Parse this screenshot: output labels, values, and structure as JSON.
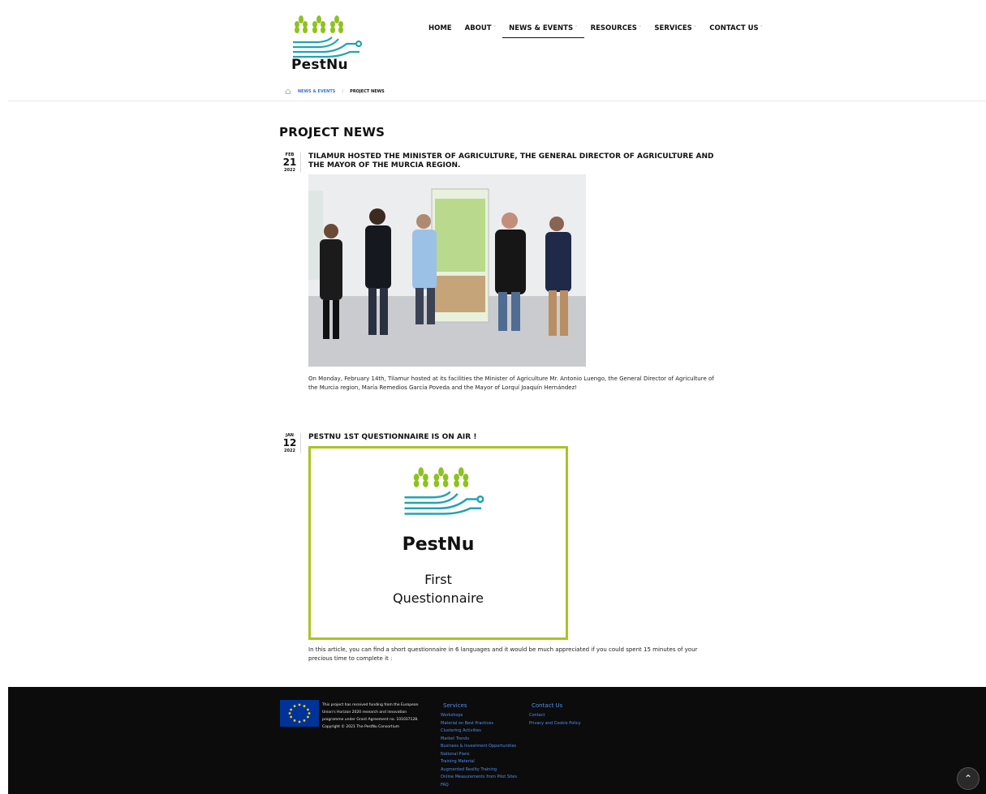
{
  "brand": {
    "name": "PestNu"
  },
  "nav": {
    "home": "HOME",
    "about": "ABOUT",
    "news": "NEWS & EVENTS",
    "resources": "RESOURCES",
    "services": "SERVICES",
    "contact": "CONTACT US"
  },
  "breadcrumb": {
    "parent": "NEWS & EVENTS",
    "current": "PROJECT NEWS"
  },
  "page": {
    "title": "PROJECT NEWS"
  },
  "posts": [
    {
      "month": "FEB",
      "day": "21",
      "year": "2022",
      "title": "TILAMUR HOSTED THE MINISTER OF AGRICULTURE, THE GENERAL DIRECTOR OF AGRICULTURE AND THE MAYOR OF THE MURCIA REGION.",
      "body": "On Monday, February 14th, Tilamur hosted at its facilities the Minister of Agriculture Mr. Antonio Luengo, the General Director of Agriculture of the Murcia region, María Remedios García Poveda and the Mayor of Lorquí Joaquín Hernández!"
    },
    {
      "month": "JAN",
      "day": "12",
      "year": "2022",
      "title": "PESTNU 1ST QUESTIONNAIRE IS ON AIR !",
      "poster_brand": "PestNu",
      "poster_line1": "First",
      "poster_line2": "Questionnaire",
      "body": "In this article, you can find a short questionnaire in 6 languages and it would be much appreciated if you could spent 15 minutes of your precious time to complete it :"
    }
  ],
  "footer": {
    "funding": "This project has received funding from the European Union's Horizon 2020 research and innovation programme under Grant Agreement no. 101037128. Copyright © 2021 The PestNu Consortium",
    "services_heading": "Services",
    "services": [
      "Workshops",
      "Material on Best Practices",
      "Clustering Activities",
      "Market Trends",
      "Business & Investment Opportunities",
      "National Plans",
      "Training Material",
      "Augmented Reality Training",
      "Online Measurements from Pilot Sites",
      "FAQ"
    ],
    "contact_heading": "Contact Us",
    "contact_links": [
      "Contact",
      "Privacy and Cookie Policy"
    ]
  },
  "colors": {
    "accent_green": "#a7c622",
    "accent_teal": "#23a3b0",
    "link_blue": "#4f8ff0"
  }
}
